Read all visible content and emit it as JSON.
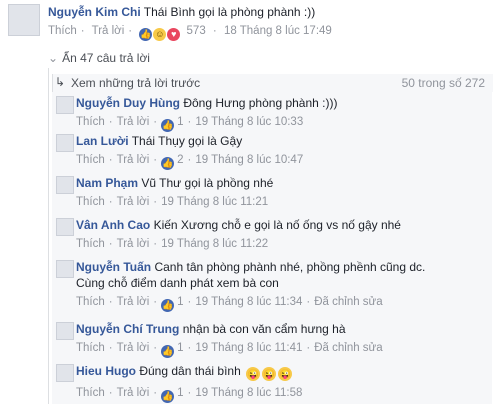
{
  "top_comment": {
    "author": "Nguyễn Kim Chi",
    "text": "Thái Bình gọi là phòng phành :))",
    "like": "Thích",
    "reply": "Trả lời",
    "reaction_count": "573",
    "time": "18 Tháng 8 lúc 17:49"
  },
  "toggle": {
    "label": "Ẩn 47 câu trả lời"
  },
  "previous": {
    "label": "Xem những trả lời trước",
    "pager": "50 trong số 272"
  },
  "replies": [
    {
      "author": "Nguyễn Duy Hùng",
      "text": "Đông Hưng phòng phành :)))",
      "like": "Thích",
      "reply": "Trả lời",
      "reactions": "1",
      "time": "19 Tháng 8 lúc 10:33",
      "edited": ""
    },
    {
      "author": "Lan Lười",
      "text": "Thái Thụy gọi là Gậy",
      "like": "Thích",
      "reply": "Trả lời",
      "reactions": "2",
      "time": "19 Tháng 8 lúc 10:47",
      "edited": ""
    },
    {
      "author": "Nam Phạm",
      "text": "Vũ Thư gọi là phồng nhé",
      "like": "Thích",
      "reply": "Trả lời",
      "reactions": "",
      "time": "19 Tháng 8 lúc 11:21",
      "edited": ""
    },
    {
      "author": "Vân Anh Cao",
      "text": "Kiến Xương chỗ e gọi là nố ống vs nố gậy nhé",
      "like": "Thích",
      "reply": "Trả lời",
      "reactions": "",
      "time": "19 Tháng 8 lúc 11:22",
      "edited": ""
    },
    {
      "author": "Nguyễn Tuấn",
      "text": "Canh tân phòng phành nhé, phồng phềnh cũng dc.",
      "text2": "Cùng chỗ điểm danh phát xem bà con",
      "like": "Thích",
      "reply": "Trả lời",
      "reactions": "1",
      "time": "19 Tháng 8 lúc 11:34",
      "edited": "Đã chỉnh sửa"
    },
    {
      "author": "Nguyễn Chí Trung",
      "text": "nhận bà con văn cẩm hưng hà",
      "like": "Thích",
      "reply": "Trả lời",
      "reactions": "1",
      "time": "19 Tháng 8 lúc 11:41",
      "edited": "Đã chỉnh sửa"
    },
    {
      "author": "Hieu Hugo",
      "text": "Đúng dân thái bình",
      "like": "Thích",
      "reply": "Trả lời",
      "reactions": "1",
      "time": "19 Tháng 8 lúc 11:58",
      "edited": ""
    }
  ],
  "colors": {
    "name": "#365899",
    "meta": "#90949c",
    "like": "#4267b2"
  }
}
